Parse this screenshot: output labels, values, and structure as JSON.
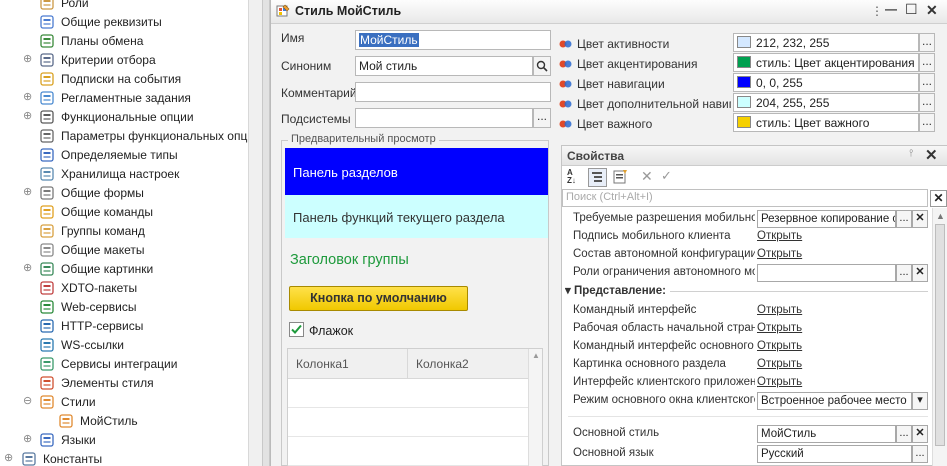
{
  "tree": {
    "items": [
      {
        "label": "Роли",
        "icon": "roles-icon",
        "expander": "",
        "indent": 0
      },
      {
        "label": "Общие реквизиты",
        "icon": "attribute-icon",
        "expander": "",
        "indent": 0
      },
      {
        "label": "Планы обмена",
        "icon": "exchange-plan-icon",
        "expander": "",
        "indent": 0
      },
      {
        "label": "Критерии отбора",
        "icon": "filter-criteria-icon",
        "expander": "⊕",
        "indent": 0
      },
      {
        "label": "Подписки на события",
        "icon": "event-subscription-icon",
        "expander": "",
        "indent": 0
      },
      {
        "label": "Регламентные задания",
        "icon": "scheduled-job-icon",
        "expander": "⊕",
        "indent": 0
      },
      {
        "label": "Функциональные опции",
        "icon": "functional-option-icon",
        "expander": "⊕",
        "indent": 0
      },
      {
        "label": "Параметры функциональных опций",
        "icon": "parameter-icon",
        "expander": "",
        "indent": 0
      },
      {
        "label": "Определяемые типы",
        "icon": "defined-type-icon",
        "expander": "",
        "indent": 0
      },
      {
        "label": "Хранилища настроек",
        "icon": "settings-storage-icon",
        "expander": "",
        "indent": 0
      },
      {
        "label": "Общие формы",
        "icon": "form-icon",
        "expander": "⊕",
        "indent": 0
      },
      {
        "label": "Общие команды",
        "icon": "command-icon",
        "expander": "",
        "indent": 0
      },
      {
        "label": "Группы команд",
        "icon": "command-group-icon",
        "expander": "",
        "indent": 0
      },
      {
        "label": "Общие макеты",
        "icon": "template-icon",
        "expander": "",
        "indent": 0
      },
      {
        "label": "Общие картинки",
        "icon": "picture-icon",
        "expander": "⊕",
        "indent": 0
      },
      {
        "label": "XDTO-пакеты",
        "icon": "xdto-icon",
        "expander": "",
        "indent": 0
      },
      {
        "label": "Web-сервисы",
        "icon": "web-service-icon",
        "expander": "",
        "indent": 0
      },
      {
        "label": "HTTP-сервисы",
        "icon": "http-service-icon",
        "expander": "",
        "indent": 0
      },
      {
        "label": "WS-ссылки",
        "icon": "ws-link-icon",
        "expander": "",
        "indent": 0
      },
      {
        "label": "Сервисы интеграции",
        "icon": "integration-service-icon",
        "expander": "",
        "indent": 0
      },
      {
        "label": "Элементы стиля",
        "icon": "style-item-icon",
        "expander": "",
        "indent": 0
      },
      {
        "label": "Стили",
        "icon": "style-icon",
        "expander": "⊖",
        "indent": 0
      },
      {
        "label": "МойСтиль",
        "icon": "style-icon",
        "expander": "",
        "indent": 1
      },
      {
        "label": "Языки",
        "icon": "language-icon",
        "expander": "⊕",
        "indent": 0
      },
      {
        "label": "Константы",
        "icon": "constants-icon",
        "expander": "⊕",
        "indent": -1
      }
    ]
  },
  "window": {
    "title": "Стиль МойСтиль",
    "controls": [
      "⋮",
      "—",
      "☐",
      "✕"
    ]
  },
  "form": {
    "name_label": "Имя",
    "name_value": "МойСтиль",
    "synonym_label": "Синоним",
    "synonym_value": "Мой стиль",
    "comment_label": "Комментарий",
    "comment_value": "",
    "subsystems_label": "Подсистемы",
    "subsystems_value": "",
    "dots": "...",
    "search_icon": "magnifier-icon"
  },
  "preview": {
    "group_label": "Предварительный просмотр",
    "sections_panel": "Панель разделов",
    "functions_panel": "Панель функций текущего раздела",
    "group_header": "Заголовок группы",
    "default_button": "Кнопка по умолчанию",
    "checkbox_label": "Флажок",
    "checkbox_checked": true,
    "columns": [
      "Колонка1",
      "Колонка2"
    ],
    "colors": {
      "sections_bg": "#0000ff",
      "functions_bg": "#ccffff",
      "group_header": "#1e9a3c",
      "button_bg": "#f5d000"
    }
  },
  "colors": [
    {
      "label": "Цвет активности",
      "value": "212, 232, 255",
      "swatch": "#d4e8ff"
    },
    {
      "label": "Цвет акцентирования",
      "value": "стиль: Цвет акцентирования",
      "swatch": "#00a050"
    },
    {
      "label": "Цвет навигации",
      "value": "0, 0, 255",
      "swatch": "#0000ff"
    },
    {
      "label": "Цвет дополнительной навиг...",
      "value": "204, 255, 255",
      "swatch": "#ccffff"
    },
    {
      "label": "Цвет важного",
      "value": "стиль: Цвет важного",
      "swatch": "#f5d000"
    }
  ],
  "properties": {
    "title": "Свойства",
    "search_placeholder": "Поиск (Ctrl+Alt+I)",
    "rows": [
      {
        "label": "Требуемые разрешения мобильног",
        "kind": "field",
        "value": "Резервное копирование с",
        "buttons": [
          "...",
          "✕"
        ]
      },
      {
        "label": "Подпись мобильного клиента",
        "kind": "link",
        "value": "Открыть"
      },
      {
        "label": "Состав автономной конфигурации",
        "kind": "link",
        "value": "Открыть"
      },
      {
        "label": "Роли ограничения автономного мо",
        "kind": "field",
        "value": "",
        "buttons": [
          "...",
          "✕"
        ]
      },
      {
        "label": "Представление:",
        "kind": "section"
      },
      {
        "label": "Командный интерфейс",
        "kind": "link",
        "value": "Открыть"
      },
      {
        "label": "Рабочая область начальной страни",
        "kind": "link",
        "value": "Открыть"
      },
      {
        "label": "Командный интерфейс основного р",
        "kind": "link",
        "value": "Открыть"
      },
      {
        "label": "Картинка основного раздела",
        "kind": "link",
        "value": "Открыть"
      },
      {
        "label": "Интерфейс клиентского приложен",
        "kind": "link",
        "value": "Открыть"
      },
      {
        "label": "Режим основного окна клиентского",
        "kind": "select",
        "value": "Встроенное рабочее место"
      },
      {
        "label": "",
        "kind": "spacer"
      },
      {
        "label": "Основной стиль",
        "kind": "field",
        "value": "МойСтиль",
        "buttons": [
          "...",
          "✕"
        ]
      },
      {
        "label": "Основной язык",
        "kind": "field",
        "value": "Русский",
        "buttons": [
          "..."
        ]
      }
    ]
  }
}
